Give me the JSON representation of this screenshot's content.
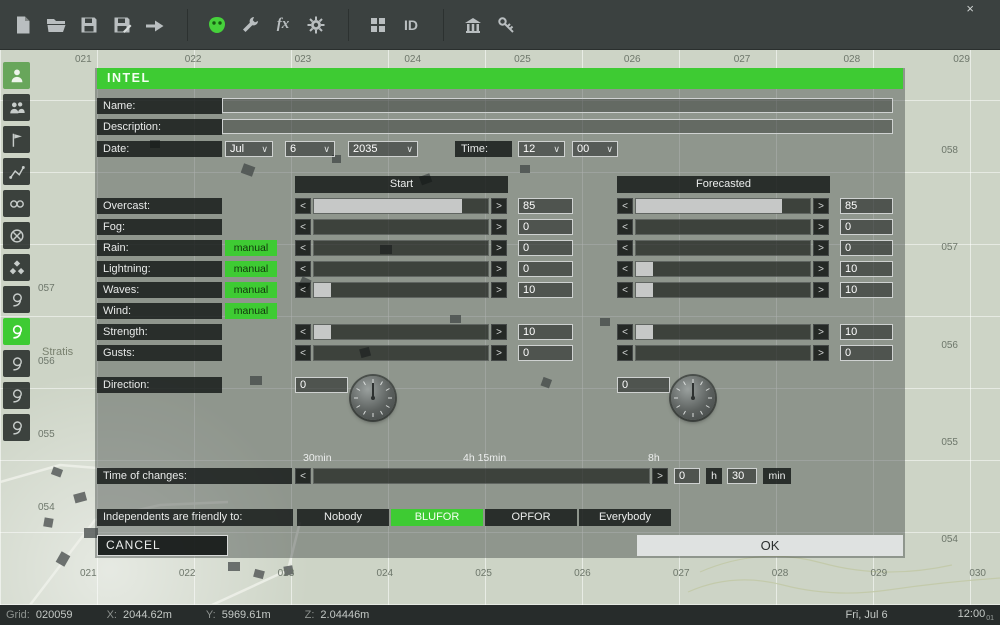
{
  "window": {
    "close_glyph": "×"
  },
  "toolbar": {
    "fx_label": "fx",
    "id_label": "ID",
    "icons": [
      "new-file",
      "open-folder",
      "save",
      "save-copy",
      "export",
      "addons",
      "tools",
      "functions",
      "settings",
      "modules-grid",
      "id",
      "structures",
      "keys"
    ]
  },
  "sidebar": {
    "icons": [
      "units",
      "groups",
      "triggers",
      "waypoints",
      "synchronize",
      "markers",
      "modules",
      "sensor-1",
      "intel",
      "sensor-2",
      "sensor-3",
      "sensor-4"
    ]
  },
  "map": {
    "region_label": "Stratis",
    "grid_top": [
      "021",
      "022",
      "023",
      "024",
      "025",
      "026",
      "027",
      "028",
      "029"
    ],
    "grid_bottom": [
      "021",
      "022",
      "023",
      "024",
      "025",
      "026",
      "027",
      "028",
      "029",
      "030"
    ],
    "grid_right": [
      "058",
      "057",
      "056",
      "055",
      "054"
    ],
    "grid_left": [
      "057",
      "056",
      "055",
      "054"
    ]
  },
  "dialog": {
    "title": "INTEL",
    "name_label": "Name:",
    "description_label": "Description:",
    "date_label": "Date:",
    "time_label": "Time:",
    "date_month": "Jul",
    "date_day": "6",
    "date_year": "2035",
    "time_hour": "12",
    "time_minute": "00",
    "chevron": "∨",
    "arrow_left": "<",
    "arrow_right": ">",
    "manual_label": "manual",
    "column_start": "Start",
    "column_forecast": "Forecasted",
    "weather_rows": [
      {
        "label": "Overcast:",
        "manual": false,
        "has_slider": true,
        "start_value": "85",
        "start_pct": 85,
        "forecast_value": "85",
        "forecast_pct": 84
      },
      {
        "label": "Fog:",
        "manual": false,
        "has_slider": true,
        "start_value": "0",
        "start_pct": 0,
        "forecast_value": "0",
        "forecast_pct": 0
      },
      {
        "label": "Rain:",
        "manual": true,
        "has_slider": true,
        "start_value": "0",
        "start_pct": 0,
        "forecast_value": "0",
        "forecast_pct": 0
      },
      {
        "label": "Lightning:",
        "manual": true,
        "has_slider": true,
        "start_value": "0",
        "start_pct": 0,
        "forecast_value": "10",
        "forecast_pct": 10
      },
      {
        "label": "Waves:",
        "manual": true,
        "has_slider": true,
        "start_value": "10",
        "start_pct": 10,
        "forecast_value": "10",
        "forecast_pct": 10
      },
      {
        "label": "Wind:",
        "manual": true,
        "has_slider": false
      },
      {
        "label": "Strength:",
        "manual": false,
        "has_slider": true,
        "start_value": "10",
        "start_pct": 10,
        "forecast_value": "10",
        "forecast_pct": 10
      },
      {
        "label": "Gusts:",
        "manual": false,
        "has_slider": true,
        "start_value": "0",
        "start_pct": 0,
        "forecast_value": "0",
        "forecast_pct": 0
      }
    ],
    "direction_label": "Direction:",
    "direction_start": "0",
    "direction_forecast": "0",
    "time_of_changes": {
      "label": "Time of changes:",
      "ticks": [
        "30min",
        "4h 15min",
        "8h"
      ],
      "hours_value": "0",
      "hours_unit": "h",
      "minutes_value": "30",
      "minutes_unit": "min"
    },
    "independents": {
      "label": "Independents are friendly to:",
      "options": [
        "Nobody",
        "BLUFOR",
        "OPFOR",
        "Everybody"
      ],
      "selected": "BLUFOR"
    },
    "cancel_label": "CANCEL",
    "ok_label": "OK"
  },
  "status_bar": {
    "grid_label": "Grid:",
    "grid_value": "020059",
    "x_label": "X:",
    "x_value": "2044.62m",
    "y_label": "Y:",
    "y_value": "5969.61m",
    "z_label": "Z:",
    "z_value": "2.04446m",
    "date": "Fri, Jul 6",
    "time": "12:00",
    "time_seconds": "01"
  }
}
